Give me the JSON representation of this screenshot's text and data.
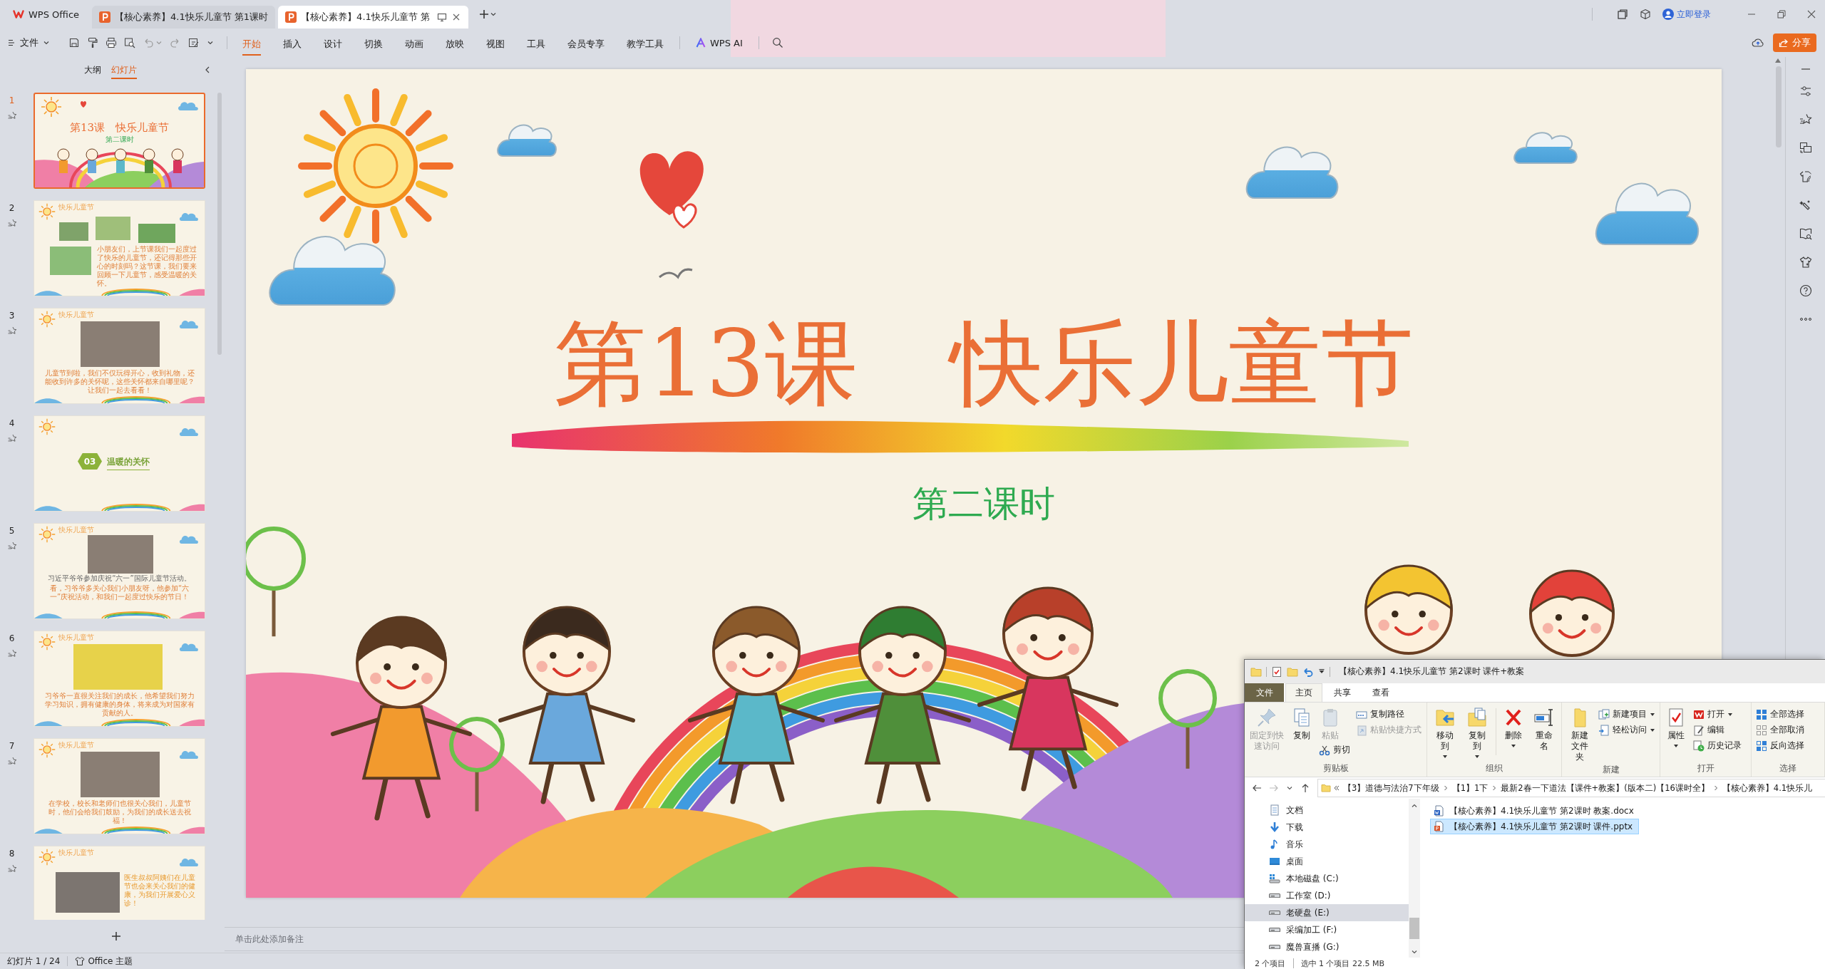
{
  "title_bar": {
    "app_name": "WPS Office",
    "tabs": [
      {
        "label": "【核心素养】4.1快乐儿童节 第1课时",
        "selected": false
      },
      {
        "label": "【核心素养】4.1快乐儿童节 第",
        "selected": true
      }
    ],
    "login": "立即登录"
  },
  "menu_bar": {
    "file_menu": "文件",
    "tabs": [
      {
        "label": "开始",
        "selected": true
      },
      {
        "label": "插入",
        "selected": false
      },
      {
        "label": "设计",
        "selected": false
      },
      {
        "label": "切换",
        "selected": false
      },
      {
        "label": "动画",
        "selected": false
      },
      {
        "label": "放映",
        "selected": false
      },
      {
        "label": "视图",
        "selected": false
      },
      {
        "label": "工具",
        "selected": false
      },
      {
        "label": "会员专享",
        "selected": false
      },
      {
        "label": "教学工具",
        "selected": false
      }
    ],
    "ai_button": "WPS AI",
    "share_button": "分享"
  },
  "slide_panel": {
    "views": [
      {
        "label": "大纲",
        "selected": false
      },
      {
        "label": "幻灯片",
        "selected": true
      }
    ],
    "slides": [
      {
        "number": "1",
        "selected": true,
        "kind": "title",
        "title": "第13课　快乐儿童节",
        "subtitle": "第二课时"
      },
      {
        "number": "2",
        "selected": false,
        "kind": "collage",
        "header": "快乐儿童节",
        "caption": "小朋友们，上节课我们一起度过了快乐的儿童节，还记得那些开心的时刻吗？这节课，我们要来回顾一下儿童节，感受温暖的关怀。"
      },
      {
        "number": "3",
        "selected": false,
        "kind": "photo",
        "header": "快乐儿童节",
        "caption": "儿童节到啦，我们不仅玩得开心，收到礼物，还能收到许多的关怀呢，这些关怀都来自哪里呢？让我们一起去看看！"
      },
      {
        "number": "4",
        "selected": false,
        "kind": "section",
        "badge": "03",
        "heading": "温暖的关怀"
      },
      {
        "number": "5",
        "selected": false,
        "kind": "photo",
        "header": "快乐儿童节",
        "note": "习近平爷爷参加庆祝“六一”国际儿童节活动。",
        "caption": "看，习爷爷多关心我们小朋友呀，他参加“六一”庆祝活动，和我们一起度过快乐的节日！"
      },
      {
        "number": "6",
        "selected": false,
        "kind": "illustration",
        "header": "快乐儿童节",
        "caption": "习爷爷一直很关注我们的成长，他希望我们努力学习知识，拥有健康的身体，将来成为对国家有贡献的人。"
      },
      {
        "number": "7",
        "selected": false,
        "kind": "photo",
        "header": "快乐儿童节",
        "caption": "在学校，校长和老师们也很关心我们，儿童节时，他们会给我们鼓励，为我们的成长送去祝福！"
      },
      {
        "number": "8",
        "selected": false,
        "kind": "photo_text",
        "header": "快乐儿童节",
        "text": "医生叔叔阿姨们在儿童节也会来关心我们的健康，为我们开展爱心义诊！"
      }
    ]
  },
  "slide": {
    "title": "第13课　快乐儿童节",
    "subtitle": "第二课时"
  },
  "notes": {
    "placeholder": "单击此处添加备注"
  },
  "status_bar": {
    "slide_counter": "幻灯片 1 / 24",
    "theme": "Office 主题"
  },
  "explorer": {
    "title": "【核心素养】4.1快乐儿童节 第2课时 课件+教案",
    "tabs": [
      {
        "label": "文件",
        "kind": "menu",
        "selected": false
      },
      {
        "label": "主页",
        "kind": "tab",
        "selected": true
      },
      {
        "label": "共享",
        "kind": "tab",
        "selected": false
      },
      {
        "label": "查看",
        "kind": "tab",
        "selected": false
      }
    ],
    "ribbon": {
      "clipboard": {
        "group": "剪贴板",
        "pin": {
          "label": "固定到快速访问",
          "disabled": true
        },
        "copy": {
          "label": "复制",
          "disabled": false
        },
        "paste": {
          "label": "粘贴",
          "disabled": true
        },
        "cut": {
          "label": "剪切",
          "disabled": false
        },
        "copy_path": {
          "label": "复制路径",
          "disabled": false
        },
        "paste_shortcut": {
          "label": "粘贴快捷方式",
          "disabled": true
        }
      },
      "organize": {
        "group": "组织",
        "move_to": {
          "label": "移动到",
          "disabled": false
        },
        "copy_to": {
          "label": "复制到",
          "disabled": false
        },
        "delete": {
          "label": "删除",
          "disabled": false
        },
        "rename": {
          "label": "重命名",
          "disabled": false
        }
      },
      "new": {
        "group": "新建",
        "new_folder": {
          "label": "新建文件夹",
          "disabled": false
        },
        "new_item": {
          "label": "新建项目",
          "disabled": false
        },
        "easy_access": {
          "label": "轻松访问",
          "disabled": false
        }
      },
      "open": {
        "group": "打开",
        "properties": {
          "label": "属性",
          "disabled": false
        },
        "open": {
          "label": "打开",
          "disabled": false
        },
        "edit": {
          "label": "编辑",
          "disabled": false
        },
        "history": {
          "label": "历史记录",
          "disabled": false
        }
      },
      "select": {
        "group": "选择",
        "select_all": {
          "label": "全部选择",
          "disabled": false
        },
        "select_none": {
          "label": "全部取消",
          "disabled": false
        },
        "invert": {
          "label": "反向选择",
          "disabled": false
        }
      }
    },
    "path": [
      "【3】道德与法治7下年级",
      "【1】1下",
      "最新2春一下道法【课件+教案】(版本二)【16课时全】",
      "【核心素养】4.1快乐儿"
    ],
    "nav": [
      {
        "label": "文档",
        "kind": "documents",
        "selected": false
      },
      {
        "label": "下载",
        "kind": "downloads",
        "selected": false
      },
      {
        "label": "音乐",
        "kind": "music",
        "selected": false
      },
      {
        "label": "桌面",
        "kind": "desktop",
        "selected": false
      },
      {
        "label": "本地磁盘 (C:)",
        "kind": "systemdrive",
        "selected": false
      },
      {
        "label": "工作室 (D:)",
        "kind": "drive",
        "selected": false
      },
      {
        "label": "老硬盘 (E:)",
        "kind": "drive",
        "selected": true
      },
      {
        "label": "采编加工 (F:)",
        "kind": "drive",
        "selected": false
      },
      {
        "label": "魔兽直播 (G:)",
        "kind": "drive",
        "selected": false
      }
    ],
    "files": [
      {
        "name": "【核心素养】4.1快乐儿童节 第2课时 教案.docx",
        "kind": "docx",
        "selected": false
      },
      {
        "name": "【核心素养】4.1快乐儿童节 第2课时 课件.pptx",
        "kind": "pptx",
        "selected": true
      }
    ],
    "status": {
      "count": "2 个项目",
      "selection": "选中 1 个项目 22.5 MB"
    }
  }
}
